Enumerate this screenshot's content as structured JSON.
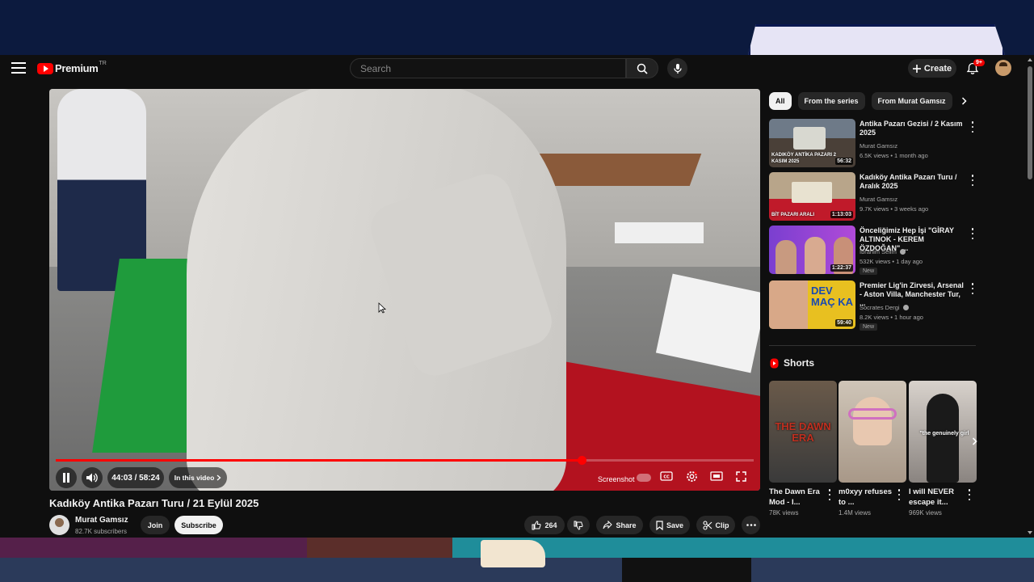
{
  "topbar": {
    "logo_text": "Premium",
    "logo_country": "TR",
    "search_placeholder": "Search",
    "create_label": "Create",
    "notifications_count": "9+"
  },
  "player": {
    "time": "44:03 / 58:24",
    "in_this_video": "In this video",
    "screenshot_label": "Screenshot",
    "progress_fraction": 0.754
  },
  "video": {
    "title": "Kadıköy Antika Pazarı Turu / 21 Eylül 2025",
    "channel": "Murat Gamsız",
    "subscribers": "82.7K subscribers",
    "join_label": "Join",
    "subscribe_label": "Subscribe",
    "likes": "264",
    "share_label": "Share",
    "save_label": "Save",
    "clip_label": "Clip"
  },
  "chips": [
    "All",
    "From the series",
    "From Murat Gamsız"
  ],
  "recommendations": [
    {
      "title": "Antika Pazarı Gezisi / 2 Kasım 2025",
      "channel": "Murat Gamsız",
      "meta": "6.5K views • 1 month ago",
      "duration": "56:32",
      "overlay": "KADIKÖY ANTİKA PAZARI 2 KASIM 2025"
    },
    {
      "title": "Kadıköy Antika Pazarı Turu / Aralık 2025",
      "channel": "Murat Gamsız",
      "meta": "9.7K views • 3 weeks ago",
      "duration": "1:13:03",
      "overlay": "BİT PAZARI ARALI"
    },
    {
      "title": "Önceliğimiz Hep İşi \"GİRAY ALTINOK - KEREM ÖZDOĞAN\" ...",
      "channel": "İbrahim Selim",
      "meta": "532K views • 1 day ago",
      "duration": "1:22:37",
      "badge": "New"
    },
    {
      "title": "Premier Lig'in Zirvesi, Arsenal - Aston Villa, Manchester Tur, ...",
      "channel": "Socrates Dergi",
      "meta": "8.2K views • 1 hour ago",
      "duration": "59:40",
      "badge": "New",
      "overlay": "DEV MAÇ KA"
    }
  ],
  "shorts": {
    "heading": "Shorts",
    "items": [
      {
        "title": "The Dawn Era Mod - I...",
        "views": "78K views",
        "overlay": "THE DAWN ERA"
      },
      {
        "title": "m0xyy refuses to ...",
        "views": "1.4M views"
      },
      {
        "title": "I will NEVER escape it... ",
        "views": "969K views",
        "overlay": "\"the genuinely girl"
      }
    ]
  },
  "colors": {
    "accent": "#ff0000",
    "background": "#0f0f0f",
    "pill": "#272727"
  }
}
